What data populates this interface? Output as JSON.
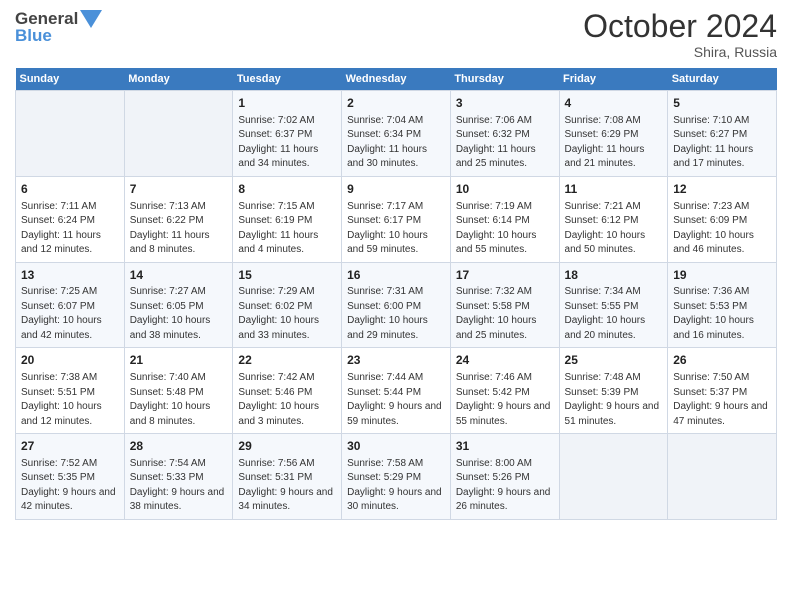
{
  "header": {
    "logo_line1": "General",
    "logo_line2": "Blue",
    "month_title": "October 2024",
    "subtitle": "Shira, Russia"
  },
  "days_of_week": [
    "Sunday",
    "Monday",
    "Tuesday",
    "Wednesday",
    "Thursday",
    "Friday",
    "Saturday"
  ],
  "weeks": [
    [
      {
        "day": "",
        "info": ""
      },
      {
        "day": "",
        "info": ""
      },
      {
        "day": "1",
        "info": "Sunrise: 7:02 AM\nSunset: 6:37 PM\nDaylight: 11 hours and 34 minutes."
      },
      {
        "day": "2",
        "info": "Sunrise: 7:04 AM\nSunset: 6:34 PM\nDaylight: 11 hours and 30 minutes."
      },
      {
        "day": "3",
        "info": "Sunrise: 7:06 AM\nSunset: 6:32 PM\nDaylight: 11 hours and 25 minutes."
      },
      {
        "day": "4",
        "info": "Sunrise: 7:08 AM\nSunset: 6:29 PM\nDaylight: 11 hours and 21 minutes."
      },
      {
        "day": "5",
        "info": "Sunrise: 7:10 AM\nSunset: 6:27 PM\nDaylight: 11 hours and 17 minutes."
      }
    ],
    [
      {
        "day": "6",
        "info": "Sunrise: 7:11 AM\nSunset: 6:24 PM\nDaylight: 11 hours and 12 minutes."
      },
      {
        "day": "7",
        "info": "Sunrise: 7:13 AM\nSunset: 6:22 PM\nDaylight: 11 hours and 8 minutes."
      },
      {
        "day": "8",
        "info": "Sunrise: 7:15 AM\nSunset: 6:19 PM\nDaylight: 11 hours and 4 minutes."
      },
      {
        "day": "9",
        "info": "Sunrise: 7:17 AM\nSunset: 6:17 PM\nDaylight: 10 hours and 59 minutes."
      },
      {
        "day": "10",
        "info": "Sunrise: 7:19 AM\nSunset: 6:14 PM\nDaylight: 10 hours and 55 minutes."
      },
      {
        "day": "11",
        "info": "Sunrise: 7:21 AM\nSunset: 6:12 PM\nDaylight: 10 hours and 50 minutes."
      },
      {
        "day": "12",
        "info": "Sunrise: 7:23 AM\nSunset: 6:09 PM\nDaylight: 10 hours and 46 minutes."
      }
    ],
    [
      {
        "day": "13",
        "info": "Sunrise: 7:25 AM\nSunset: 6:07 PM\nDaylight: 10 hours and 42 minutes."
      },
      {
        "day": "14",
        "info": "Sunrise: 7:27 AM\nSunset: 6:05 PM\nDaylight: 10 hours and 38 minutes."
      },
      {
        "day": "15",
        "info": "Sunrise: 7:29 AM\nSunset: 6:02 PM\nDaylight: 10 hours and 33 minutes."
      },
      {
        "day": "16",
        "info": "Sunrise: 7:31 AM\nSunset: 6:00 PM\nDaylight: 10 hours and 29 minutes."
      },
      {
        "day": "17",
        "info": "Sunrise: 7:32 AM\nSunset: 5:58 PM\nDaylight: 10 hours and 25 minutes."
      },
      {
        "day": "18",
        "info": "Sunrise: 7:34 AM\nSunset: 5:55 PM\nDaylight: 10 hours and 20 minutes."
      },
      {
        "day": "19",
        "info": "Sunrise: 7:36 AM\nSunset: 5:53 PM\nDaylight: 10 hours and 16 minutes."
      }
    ],
    [
      {
        "day": "20",
        "info": "Sunrise: 7:38 AM\nSunset: 5:51 PM\nDaylight: 10 hours and 12 minutes."
      },
      {
        "day": "21",
        "info": "Sunrise: 7:40 AM\nSunset: 5:48 PM\nDaylight: 10 hours and 8 minutes."
      },
      {
        "day": "22",
        "info": "Sunrise: 7:42 AM\nSunset: 5:46 PM\nDaylight: 10 hours and 3 minutes."
      },
      {
        "day": "23",
        "info": "Sunrise: 7:44 AM\nSunset: 5:44 PM\nDaylight: 9 hours and 59 minutes."
      },
      {
        "day": "24",
        "info": "Sunrise: 7:46 AM\nSunset: 5:42 PM\nDaylight: 9 hours and 55 minutes."
      },
      {
        "day": "25",
        "info": "Sunrise: 7:48 AM\nSunset: 5:39 PM\nDaylight: 9 hours and 51 minutes."
      },
      {
        "day": "26",
        "info": "Sunrise: 7:50 AM\nSunset: 5:37 PM\nDaylight: 9 hours and 47 minutes."
      }
    ],
    [
      {
        "day": "27",
        "info": "Sunrise: 7:52 AM\nSunset: 5:35 PM\nDaylight: 9 hours and 42 minutes."
      },
      {
        "day": "28",
        "info": "Sunrise: 7:54 AM\nSunset: 5:33 PM\nDaylight: 9 hours and 38 minutes."
      },
      {
        "day": "29",
        "info": "Sunrise: 7:56 AM\nSunset: 5:31 PM\nDaylight: 9 hours and 34 minutes."
      },
      {
        "day": "30",
        "info": "Sunrise: 7:58 AM\nSunset: 5:29 PM\nDaylight: 9 hours and 30 minutes."
      },
      {
        "day": "31",
        "info": "Sunrise: 8:00 AM\nSunset: 5:26 PM\nDaylight: 9 hours and 26 minutes."
      },
      {
        "day": "",
        "info": ""
      },
      {
        "day": "",
        "info": ""
      }
    ]
  ]
}
